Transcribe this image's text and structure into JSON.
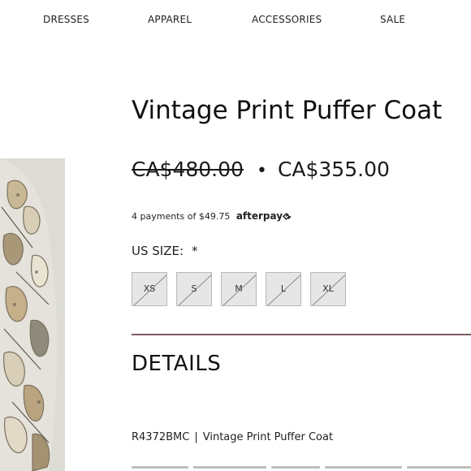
{
  "nav": {
    "items": [
      {
        "label": "DRESSES"
      },
      {
        "label": "APPAREL"
      },
      {
        "label": "ACCESSORIES"
      },
      {
        "label": "SALE"
      }
    ]
  },
  "product": {
    "title": "Vintage Print Puffer Coat",
    "price_original": "CA$480.00",
    "price_separator": "•",
    "price_sale": "CA$355.00",
    "afterpay_text": "4 payments of $49.75",
    "afterpay_brand": "afterpay",
    "size_label": "US SIZE:",
    "size_required": "*",
    "sizes": [
      {
        "label": "XS",
        "available": false
      },
      {
        "label": "S",
        "available": false
      },
      {
        "label": "M",
        "available": false
      },
      {
        "label": "L",
        "available": false
      },
      {
        "label": "XL",
        "available": false
      }
    ],
    "details_heading": "DETAILS",
    "sku": "R4372BMC",
    "sku_separator": "|",
    "sku_name": "Vintage Print Puffer Coat"
  },
  "colors": {
    "divider": "#7a5c60",
    "size_disabled_bg": "#e6e6e6"
  }
}
